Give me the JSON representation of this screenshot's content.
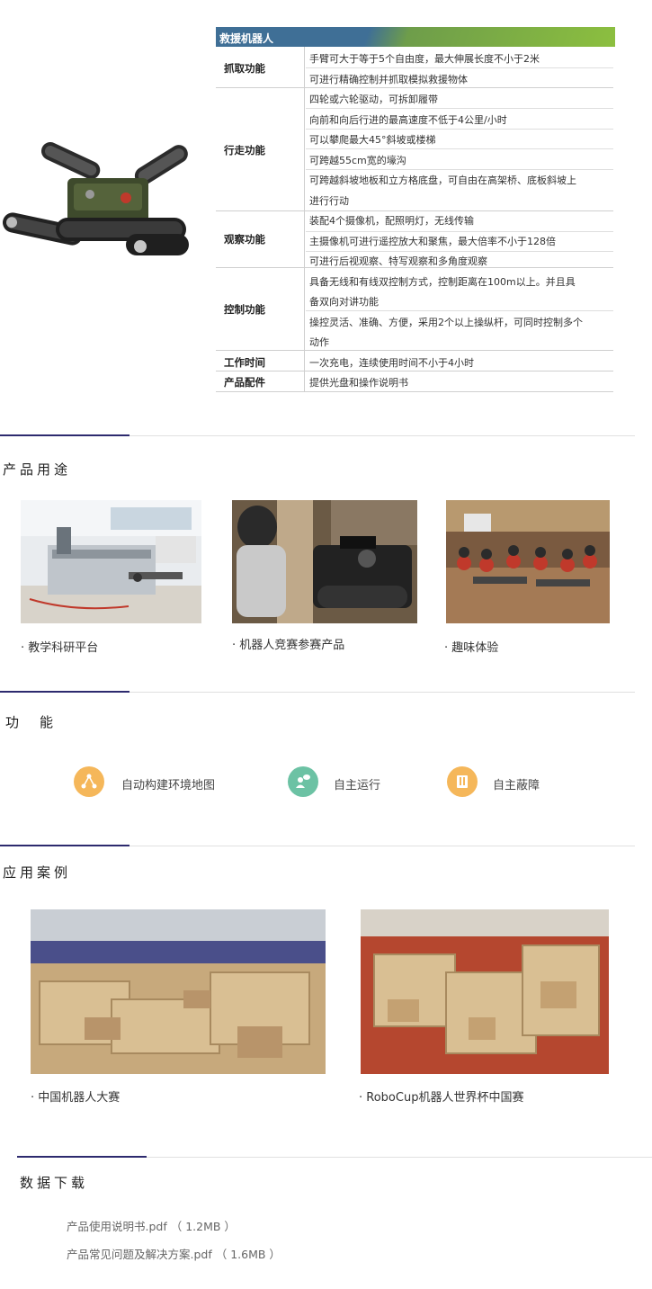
{
  "spec": {
    "title": "救援机器人",
    "rows": [
      {
        "label": "抓取功能",
        "lines": [
          "手臂可大于等于5个自由度，最大伸展长度不小于2米",
          "可进行精确控制并抓取模拟救援物体"
        ]
      },
      {
        "label": "行走功能",
        "lines": [
          "四轮或六轮驱动，可拆卸履带",
          "向前和向后行进的最高速度不低于4公里/小时",
          "可以攀爬最大45°斜坡或楼梯",
          "可跨越55cm宽的壕沟",
          "可跨越斜坡地板和立方格底盘，可自由在高架桥、底板斜坡上",
          "进行行动"
        ]
      },
      {
        "label": "观察功能",
        "lines": [
          "装配4个摄像机，配照明灯，无线传输",
          "主摄像机可进行遥控放大和聚焦，最大倍率不小于128倍",
          "可进行后视观察、特写观察和多角度观察"
        ]
      },
      {
        "label": "控制功能",
        "lines": [
          "具备无线和有线双控制方式，控制距离在100m以上。并且具",
          "备双向对讲功能",
          "操控灵活、准确、方便，采用2个以上操纵杆，可同时控制多个",
          "动作"
        ]
      },
      {
        "label": "工作时间",
        "lines": [
          "一次充电，连续使用时间不小于4小时"
        ]
      },
      {
        "label": "产品配件",
        "lines": [
          "提供光盘和操作说明书"
        ]
      }
    ]
  },
  "uses": {
    "title": "产品用途",
    "items": [
      {
        "caption": "· 教学科研平台"
      },
      {
        "caption": "· 机器人竞赛参赛产品"
      },
      {
        "caption": "· 趣味体验"
      }
    ]
  },
  "features": {
    "title": "功　能",
    "items": [
      {
        "label": "自动构建环境地图",
        "icon": "network-icon",
        "color": "#f5b75a"
      },
      {
        "label": "自主运行",
        "icon": "user-chat-icon",
        "color": "#6cc2a4"
      },
      {
        "label": "自主蔽障",
        "icon": "book-icon",
        "color": "#f5b75a"
      }
    ]
  },
  "cases": {
    "title": "应用案例",
    "items": [
      {
        "caption": "· 中国机器人大赛"
      },
      {
        "caption": "· RoboCup机器人世界杯中国赛"
      }
    ]
  },
  "downloads": {
    "title": "数据下载",
    "items": [
      {
        "name": "产品使用说明书.pdf",
        "size": "（ 1.2MB ）"
      },
      {
        "name": "产品常见问题及解决方案.pdf",
        "size": "（ 1.6MB ）"
      }
    ]
  },
  "colors": {
    "accent": "#2d2a6e",
    "header_blue": "#3f6f96",
    "header_green": "#8cbf3f"
  }
}
